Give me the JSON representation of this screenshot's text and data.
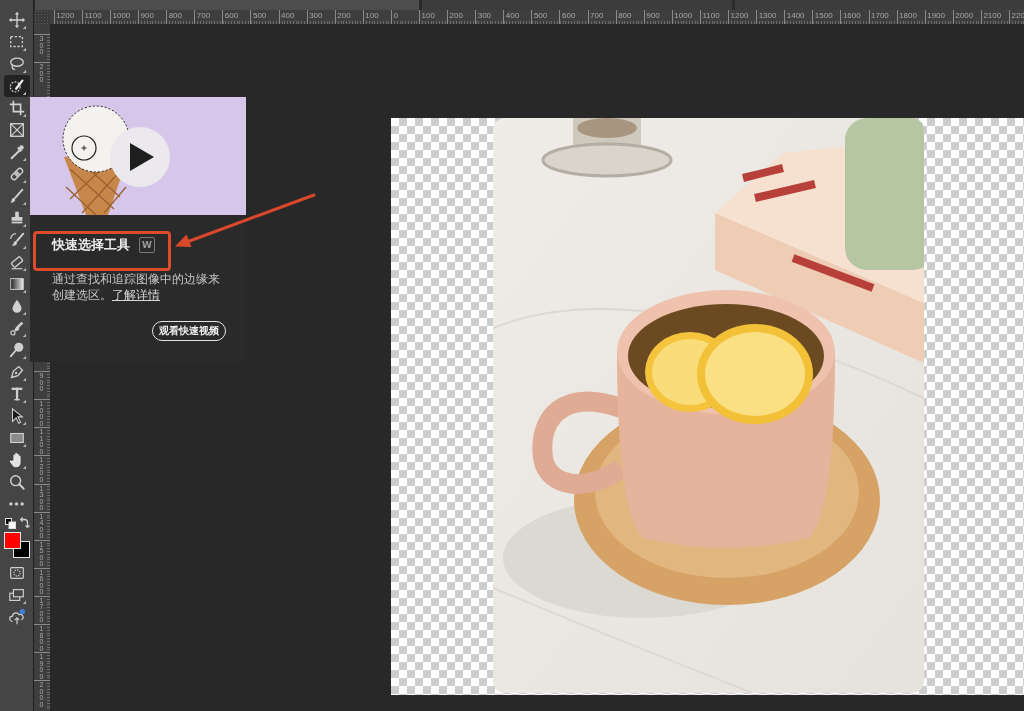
{
  "document_tabs": [
    {
      "selected": true
    },
    {
      "selected": false
    },
    {
      "selected": false
    }
  ],
  "toolbar": {
    "tools": [
      {
        "kind": "move",
        "selected": false
      },
      {
        "kind": "marquee",
        "selected": false
      },
      {
        "kind": "lasso",
        "selected": false
      },
      {
        "kind": "quick-selection",
        "selected": true
      },
      {
        "kind": "crop",
        "selected": false
      },
      {
        "kind": "frame",
        "selected": false
      },
      {
        "kind": "eyedropper",
        "selected": false
      },
      {
        "kind": "healing",
        "selected": false
      },
      {
        "kind": "brush",
        "selected": false
      },
      {
        "kind": "stamp",
        "selected": false
      },
      {
        "kind": "history-brush",
        "selected": false
      },
      {
        "kind": "eraser",
        "selected": false
      },
      {
        "kind": "gradient",
        "selected": false
      },
      {
        "kind": "blur",
        "selected": false
      },
      {
        "kind": "smudge",
        "selected": false
      },
      {
        "kind": "dodge",
        "selected": false
      },
      {
        "kind": "pen",
        "selected": false
      },
      {
        "kind": "type",
        "selected": false
      },
      {
        "kind": "path-selection",
        "selected": false
      },
      {
        "kind": "rectangle",
        "selected": false
      },
      {
        "kind": "hand",
        "selected": false
      },
      {
        "kind": "zoom",
        "selected": false
      },
      {
        "kind": "more",
        "selected": false
      }
    ]
  },
  "top_ruler": {
    "labels": [
      "1200",
      "1100",
      "1000",
      "900",
      "800",
      "700",
      "600",
      "500",
      "400",
      "300",
      "200",
      "100",
      "0",
      "100",
      "200",
      "300",
      "400",
      "500",
      "600",
      "700",
      "800",
      "900",
      "1000",
      "1100",
      "1200",
      "1300",
      "1400",
      "1500",
      "1600",
      "1700",
      "1800",
      "1900",
      "2000",
      "2100",
      "220"
    ]
  },
  "left_ruler": {
    "upper_labels": [
      "300",
      "200"
    ],
    "lower_labels": [
      "900",
      "1000",
      "1100",
      "1200",
      "1300",
      "1400",
      "1500",
      "1600",
      "1700",
      "1800",
      "1900",
      "2000"
    ]
  },
  "tool_tip": {
    "title": "快速选择工具",
    "shortcut": "W",
    "description": "通过查找和追踪图像中的边缘来创建选区。",
    "link": "了解详情",
    "button": "观看快速视频"
  }
}
